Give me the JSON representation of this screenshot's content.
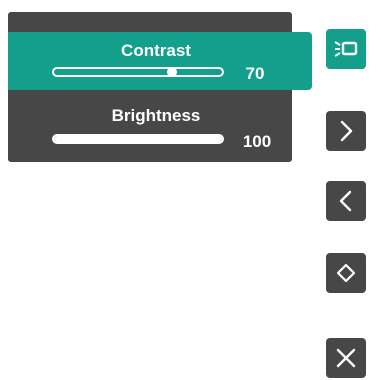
{
  "osd": {
    "rows": [
      {
        "label": "Contrast",
        "value": "70",
        "level": 0.7,
        "selected": true
      },
      {
        "label": "Brightness",
        "value": "100",
        "level": 1.0,
        "selected": false
      }
    ]
  },
  "side_buttons": [
    {
      "icon": "display-mode-icon",
      "active": true
    },
    {
      "icon": "chevron-right-icon",
      "active": false
    },
    {
      "icon": "chevron-left-icon",
      "active": false
    },
    {
      "icon": "up-down-icon",
      "active": false
    },
    {
      "icon": "close-icon",
      "active": false
    }
  ],
  "colors": {
    "panel": "#474747",
    "accent": "#149e8c",
    "text": "#ffffff"
  }
}
